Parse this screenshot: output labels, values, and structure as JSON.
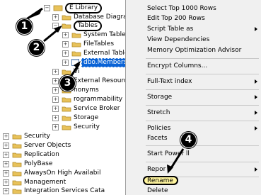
{
  "tree": {
    "database": "E Library",
    "nodes": {
      "database_diagrams": "Database Diagran",
      "tables": "Tables",
      "system_tables": "System Tables",
      "file_tables": "FileTables",
      "external_tables": "External Table",
      "selected_table": "dbo.Members",
      "views": "Vi",
      "external_resources": "External Resource",
      "synonyms": "nonyms",
      "programmability": "rogrammability",
      "service_broker": "Service Broker",
      "storage": "Storage",
      "security_inner": "Security",
      "security": "Security",
      "server_objects": "Server Objects",
      "replication": "Replication",
      "polybase": "PolyBase",
      "alwayson": "AlwaysOn High Availabil",
      "management": "Management",
      "integration_services": "Integration Services Cata"
    }
  },
  "menu": {
    "select_top": "Select Top 1000 Rows",
    "edit_top": "Edit Top 200 Rows",
    "script_table": "Script Table as",
    "view_dependencies": "View Dependencies",
    "memory_optimization": "Memory Optimization Advisor",
    "encrypt_columns": "Encrypt Columns...",
    "full_text_index": "Full-Text index",
    "storage": "Storage",
    "stretch": "Stretch",
    "policies": "Policies",
    "facets": "Facets",
    "start_powershell": "Start Power   ll",
    "reports": "Repor",
    "rename": "Rename",
    "delete": "Delete"
  },
  "callouts": [
    "1",
    "2",
    "3",
    "4"
  ],
  "colors": {
    "selection": "#0a63d6",
    "menu_bg": "#f0f0f0",
    "folder": "#e8c25a",
    "rename_highlight": "#fff59e"
  },
  "icons": [
    "expand-icon",
    "collapse-icon",
    "folder-icon",
    "table-icon",
    "submenu-arrow-icon"
  ]
}
